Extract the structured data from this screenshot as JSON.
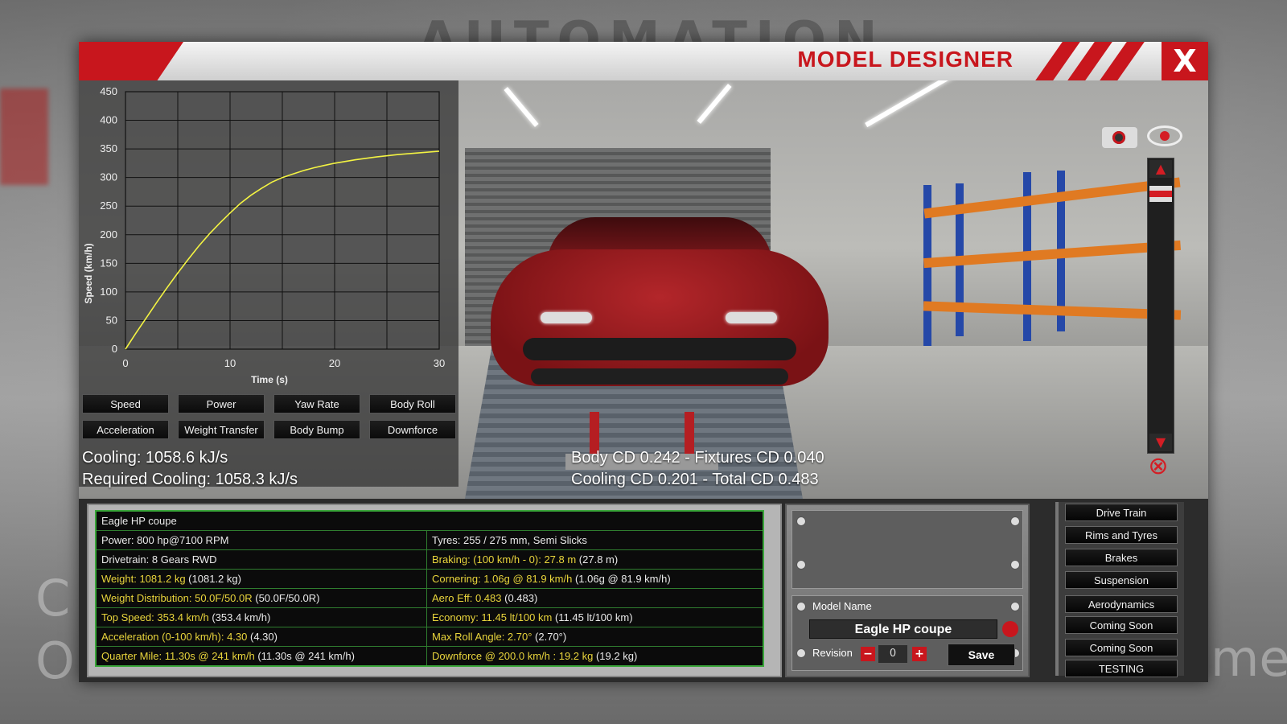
{
  "background": {
    "logo_text": "AUTOMATION"
  },
  "window": {
    "title": "MODEL DESIGNER",
    "close_label": "X"
  },
  "chart_data": {
    "type": "line",
    "xlabel": "Time (s)",
    "ylabel": "Speed (km/h)",
    "xlim": [
      0,
      30
    ],
    "ylim": [
      0,
      450
    ],
    "x_ticks": [
      "0",
      "10",
      "20",
      "30"
    ],
    "y_ticks": [
      "0",
      "50",
      "100",
      "150",
      "200",
      "250",
      "300",
      "350",
      "400",
      "450"
    ],
    "grid": true,
    "series": [
      {
        "color": "#f4f442",
        "x": [
          0,
          1,
          2,
          3,
          4,
          5,
          6,
          7,
          8,
          9,
          10,
          11,
          12,
          13,
          14,
          15,
          16,
          17,
          18,
          19,
          20,
          22,
          24,
          26,
          28,
          30
        ],
        "y": [
          0,
          28,
          55,
          82,
          108,
          133,
          157,
          180,
          201,
          220,
          238,
          255,
          269,
          281,
          292,
          300,
          306,
          312,
          317,
          321,
          325,
          331,
          336,
          340,
          343,
          346
        ]
      }
    ]
  },
  "graph_modes": {
    "row1": [
      "Speed",
      "Power",
      "Yaw Rate",
      "Body Roll"
    ],
    "row2": [
      "Acceleration",
      "Weight Transfer",
      "Body Bump",
      "Downforce"
    ]
  },
  "stats": {
    "cooling": "Cooling: 1058.6 kJ/s",
    "required_cooling": "Required Cooling: 1058.3 kJ/s",
    "body_cd": "Body CD 0.242 - Fixtures CD 0.040",
    "cooling_cd": "Cooling CD 0.201 - Total CD 0.483"
  },
  "specs": {
    "name": "Eagle HP coupe",
    "rows": [
      {
        "left": "Power: 800 hp@7100 RPM",
        "left_hl": "",
        "right": "Tyres: 255 / 275 mm, Semi Slicks",
        "right_hl": ""
      },
      {
        "left": "Drivetrain: 8 Gears RWD",
        "left_hl": "",
        "right": " (27.8 m)",
        "right_hl": "Braking: (100 km/h - 0): 27.8 m"
      },
      {
        "left": " (1081.2 kg)",
        "left_hl": "Weight: 1081.2 kg",
        "right": " (1.06g @ 81.9 km/h)",
        "right_hl": "Cornering: 1.06g @ 81.9 km/h"
      },
      {
        "left": " (50.0F/50.0R)",
        "left_hl": "Weight Distribution: 50.0F/50.0R",
        "right": " (0.483)",
        "right_hl": "Aero Eff: 0.483"
      },
      {
        "left": " (353.4 km/h)",
        "left_hl": "Top Speed: 353.4 km/h",
        "right": " (11.45 lt/100 km)",
        "right_hl": "Economy: 11.45 lt/100 km"
      },
      {
        "left": " (4.30)",
        "left_hl": "Acceleration (0-100 km/h): 4.30",
        "right": " (2.70°)",
        "right_hl": "Max Roll Angle: 2.70°"
      },
      {
        "left": " (11.30s @ 241 km/h)",
        "left_hl": "Quarter Mile: 11.30s @ 241 km/h",
        "right": " (19.2 kg)",
        "right_hl": "Downforce @ 200.0 km/h : 19.2 kg"
      }
    ]
  },
  "model": {
    "name_label": "Model Name",
    "name_value": "Eagle HP coupe",
    "revision_label": "Revision",
    "revision_value": "0",
    "minus": "−",
    "plus": "+",
    "save_label": "Save"
  },
  "categories": [
    "Drive Train",
    "Rims and Tyres",
    "Brakes",
    "Suspension",
    "Aerodynamics",
    "Coming Soon",
    "Coming Soon",
    "TESTING"
  ],
  "colors": {
    "accent_red": "#c8161d",
    "highlight_yellow": "#e9d53c",
    "table_border_green": "#3aa63a"
  }
}
